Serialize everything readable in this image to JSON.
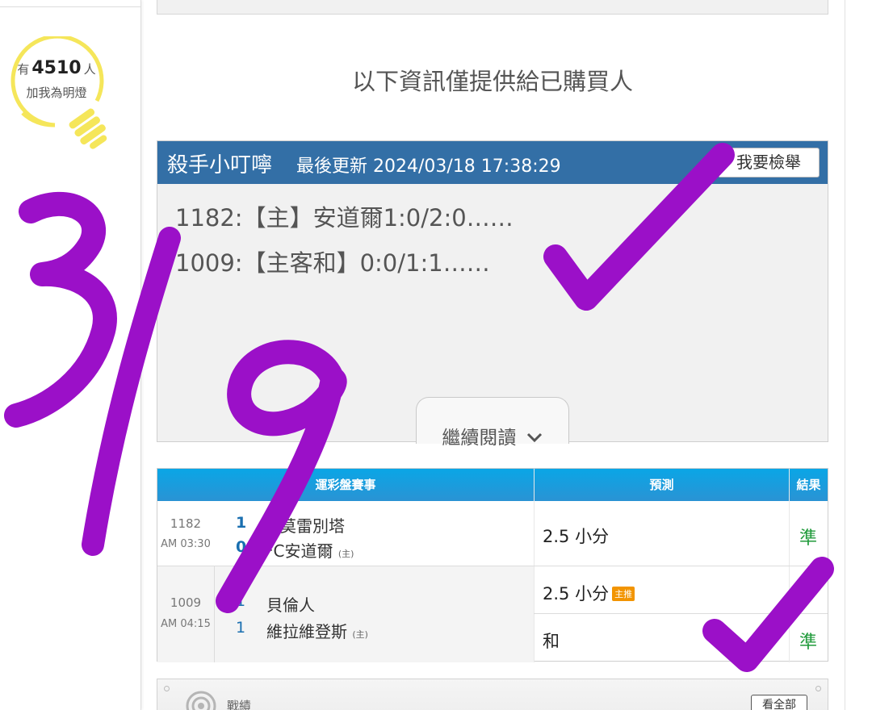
{
  "sidebar": {
    "fans_prefix": "有",
    "fans_count": "4510",
    "fans_suffix": "人",
    "fans_action": "加我為明燈"
  },
  "notice": "以下資訊僅提供給已購買人",
  "panel": {
    "author": "殺手小叮嚀",
    "updated": "最後更新 2024/03/18 17:38:29",
    "report_label": "我要檢舉",
    "picks": [
      "1182:【主】安道爾1:0/2:0……",
      "1009:【主客和】0:0/1:1……"
    ],
    "read_more": "繼續閱讀"
  },
  "table": {
    "headers": {
      "match": "運彩盤賽事",
      "prediction": "預測",
      "result": "結果"
    },
    "rows": [
      {
        "game_no": "1182",
        "time": "AM 03:30",
        "away_score": "1",
        "away_team": "列莫雷別塔",
        "home_score": "0",
        "home_team": "FC安道爾",
        "home_tag": "(主)",
        "predictions": [
          {
            "text": "2.5 小分",
            "badge": "",
            "result": "準"
          }
        ]
      },
      {
        "game_no": "1009",
        "time": "AM 04:15",
        "away_score": "1",
        "away_team": "貝倫人",
        "home_score": "1",
        "home_team": "維拉維登斯",
        "home_tag": "(主)",
        "predictions": [
          {
            "text": "2.5 小分",
            "badge": "主推",
            "result": ""
          },
          {
            "text": "和",
            "badge": "",
            "result": "準"
          }
        ]
      }
    ]
  },
  "stats": {
    "label": "戰績",
    "view_all": "看全部"
  },
  "annotation": {
    "date_note": "3/19",
    "ink_color": "#9b10c8"
  },
  "colors": {
    "header_blue": "#336fa6",
    "table_head": "#0aa6e6",
    "result_green": "#1f9a3a",
    "badge_orange": "#f29400",
    "bulb_yellow": "#f5e65a"
  }
}
